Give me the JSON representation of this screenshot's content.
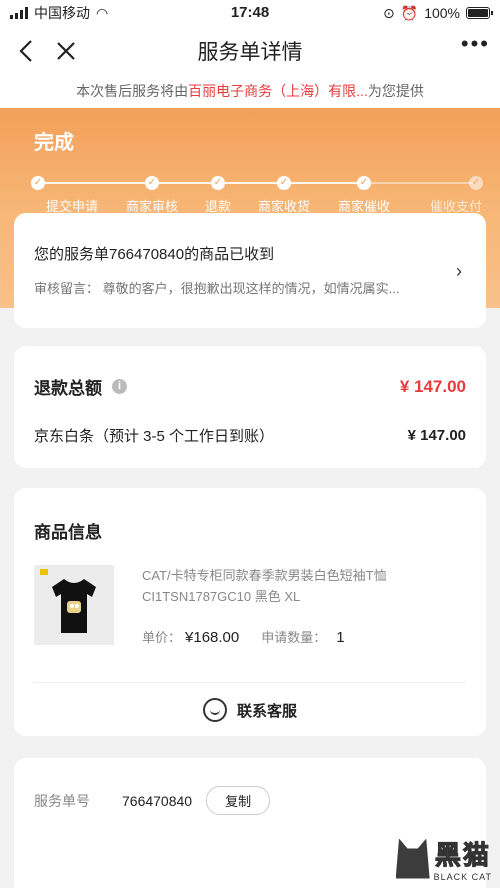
{
  "status_bar": {
    "carrier": "中国移动",
    "time": "17:48",
    "battery": "100%"
  },
  "nav": {
    "title": "服务单详情",
    "back_icon": "back-arrow-icon",
    "close_icon": "close-icon",
    "more_icon": "more-dots-icon"
  },
  "notice": {
    "prefix": "本次售后服务将由",
    "merchant": "百丽电子商务（上海）有限...",
    "suffix": "为您提供"
  },
  "progress": {
    "status": "完成",
    "steps": [
      {
        "label": "提交申请",
        "done": true
      },
      {
        "label": "商家审核",
        "done": true
      },
      {
        "label": "退款",
        "done": true
      },
      {
        "label": "商家收货",
        "done": true
      },
      {
        "label": "商家催收",
        "done": true
      },
      {
        "label": "催收支付",
        "done": false
      }
    ]
  },
  "status_card": {
    "message": "您的服务单766470840的商品已收到",
    "review_note": "审核留言： 尊敬的客户，很抱歉出现这样的情况，如情况属实..."
  },
  "refund": {
    "label": "退款总额",
    "total": "¥ 147.00",
    "method": "京东白条（预计 3-5 个工作日到账）",
    "method_amount": "¥ 147.00"
  },
  "goods": {
    "section_title": "商品信息",
    "name_line1": "CAT/卡特专柜同款春季款男装白色短袖T恤",
    "name_line2": "CI1TSN1787GC10 黑色 XL",
    "price_label": "单价：",
    "price": "¥168.00",
    "qty_label": "申请数量：",
    "qty": "1",
    "contact_label": "联系客服"
  },
  "order": {
    "label": "服务单号",
    "number": "766470840",
    "copy_label": "复制"
  },
  "watermark": {
    "cn": "黑猫",
    "en": "BLACK CAT"
  },
  "colors": {
    "accent_red": "#e93b3d",
    "hero_orange": "#f3a05a"
  }
}
